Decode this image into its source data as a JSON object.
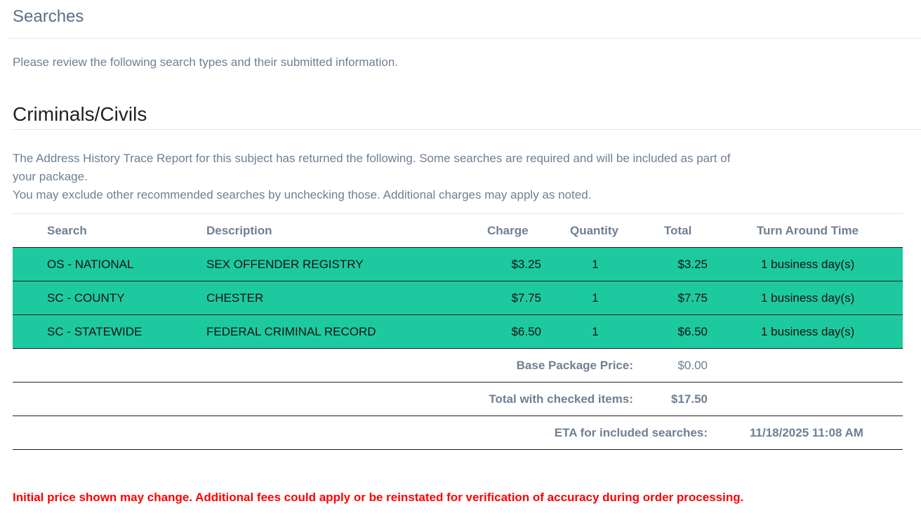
{
  "header": {
    "title": "Searches",
    "intro": "Please review the following search types and their submitted information."
  },
  "section": {
    "title": "Criminals/Civils",
    "note_line1": "The Address History Trace Report for this subject has returned the following. Some searches are required and will be included as part of your package.",
    "note_line2": "You may exclude other recommended searches by unchecking those. Additional charges may apply as noted."
  },
  "table": {
    "columns": [
      "Search",
      "Description",
      "Charge",
      "Quantity",
      "Total",
      "Turn Around Time"
    ],
    "rows": [
      {
        "search": "OS - NATIONAL",
        "description": "SEX OFFENDER REGISTRY",
        "charge": "$3.25",
        "quantity": "1",
        "total": "$3.25",
        "tat": "1 business day(s)"
      },
      {
        "search": "SC - COUNTY",
        "description": "CHESTER",
        "charge": "$7.75",
        "quantity": "1",
        "total": "$7.75",
        "tat": "1 business day(s)"
      },
      {
        "search": "SC - STATEWIDE",
        "description": "FEDERAL CRIMINAL RECORD",
        "charge": "$6.50",
        "quantity": "1",
        "total": "$6.50",
        "tat": "1 business day(s)"
      }
    ],
    "row_color": "#1dcaa0"
  },
  "summary": {
    "base_label": "Base Package Price:",
    "base_value": "$0.00",
    "total_label": "Total with checked items:",
    "total_value": "$17.50",
    "eta_label": "ETA for included searches:",
    "eta_value": "11/18/2025 11:08 AM"
  },
  "warning": "Initial price shown may change. Additional fees could apply or be reinstated for verification of accuracy during order processing."
}
